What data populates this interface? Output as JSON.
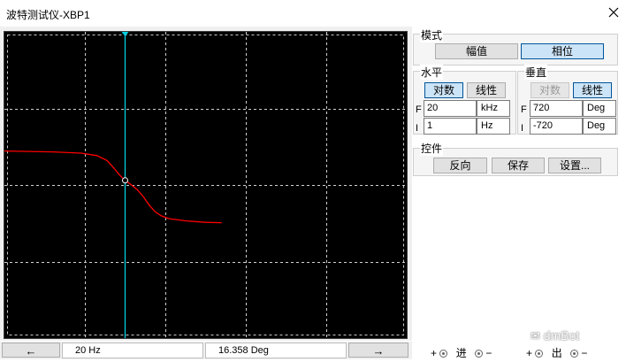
{
  "window": {
    "title": "波特测试仪-XBP1"
  },
  "plot": {
    "vertical_gridlines": 4,
    "horizontal_gridlines": 3,
    "cursor_position": 0.3,
    "trace_color": "#ff0000",
    "cursor_color": "#00d0e0",
    "trace": [
      [
        0.0,
        0.389
      ],
      [
        0.12,
        0.392
      ],
      [
        0.19,
        0.396
      ],
      [
        0.23,
        0.404
      ],
      [
        0.255,
        0.42
      ],
      [
        0.27,
        0.442
      ],
      [
        0.285,
        0.466
      ],
      [
        0.3,
        0.485
      ],
      [
        0.315,
        0.499
      ],
      [
        0.33,
        0.515
      ],
      [
        0.345,
        0.538
      ],
      [
        0.36,
        0.566
      ],
      [
        0.375,
        0.588
      ],
      [
        0.39,
        0.601
      ],
      [
        0.41,
        0.61
      ],
      [
        0.45,
        0.617
      ],
      [
        0.5,
        0.622
      ],
      [
        0.54,
        0.623
      ]
    ]
  },
  "status": {
    "left_arrow": "←",
    "frequency": "20  Hz",
    "value": "16.358 Deg",
    "right_arrow": "→"
  },
  "mode": {
    "label": "模式",
    "magnitude_button": "幅值",
    "phase_button": "相位"
  },
  "horizontal": {
    "label": "水平",
    "log_button": "对数",
    "linear_button": "线性",
    "f_value": "20",
    "f_unit": "kHz",
    "i_value": "1",
    "i_unit": "Hz"
  },
  "vertical": {
    "label": "垂直",
    "log_button": "对数",
    "linear_button": "线性",
    "f_value": "720",
    "f_unit": "Deg",
    "i_value": "-720",
    "i_unit": "Deg"
  },
  "row_labels": {
    "f": "F",
    "i": "I"
  },
  "controls": {
    "label": "控件",
    "reverse_button": "反向",
    "save_button": "保存",
    "settings_button": "设置..."
  },
  "terminals": {
    "in_plus": "+",
    "in_label": "进",
    "in_minus": "−",
    "out_plus": "+",
    "out_label": "出",
    "out_minus": "−"
  },
  "watermark": "dmBot"
}
